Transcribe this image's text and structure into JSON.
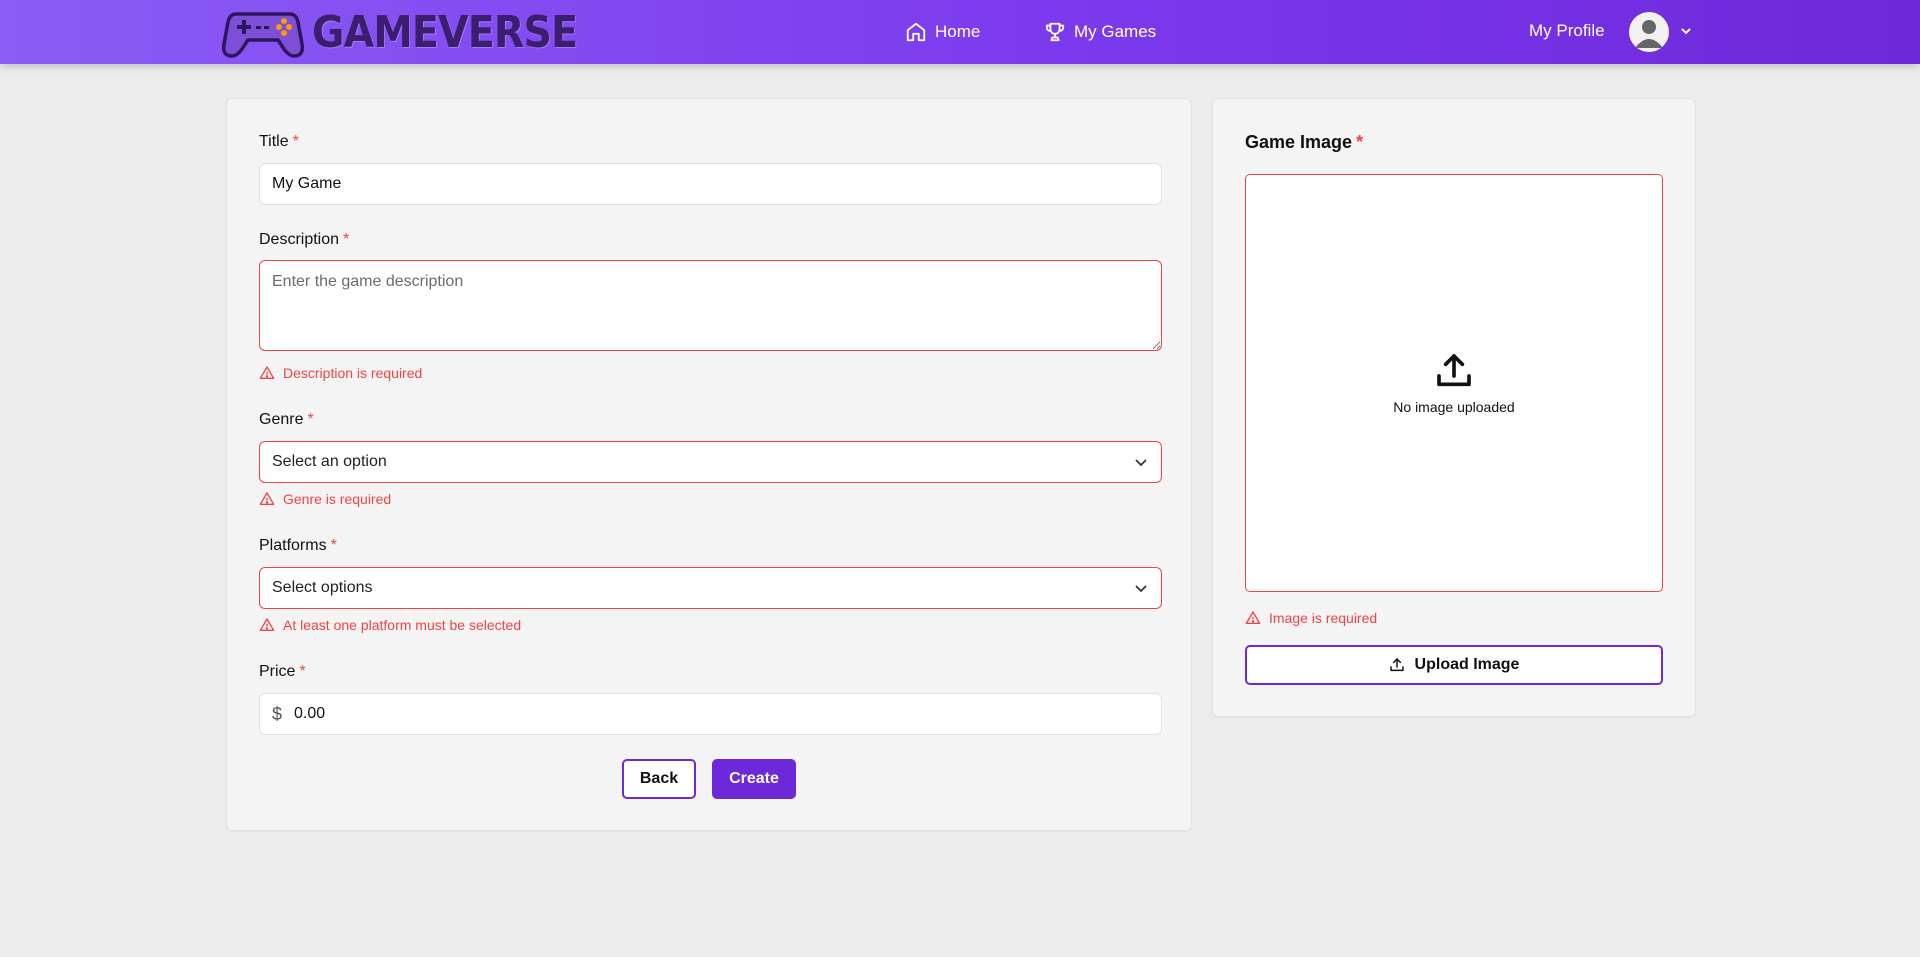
{
  "header": {
    "brand": "GAMEVERSE",
    "nav": [
      {
        "label": "Home",
        "icon": "home-icon"
      },
      {
        "label": "My Games",
        "icon": "trophy-icon"
      }
    ],
    "profile_label": "My Profile"
  },
  "form": {
    "title": {
      "label": "Title",
      "required_mark": "*",
      "value": "My Game"
    },
    "description": {
      "label": "Description",
      "required_mark": "*",
      "placeholder": "Enter the game description",
      "error": "Description is required"
    },
    "genre": {
      "label": "Genre",
      "required_mark": "*",
      "value": "Select an option",
      "error": "Genre is required"
    },
    "platforms": {
      "label": "Platforms",
      "required_mark": "*",
      "value": "Select options",
      "error": "At least one platform must be selected"
    },
    "price": {
      "label": "Price",
      "required_mark": "*",
      "currency_symbol": "$",
      "value": "0.00"
    },
    "back_label": "Back",
    "create_label": "Create"
  },
  "image": {
    "title": "Game Image",
    "required_mark": "*",
    "empty_text": "No image uploaded",
    "error": "Image is required",
    "upload_label": "Upload Image"
  },
  "colors": {
    "accent": "#6d28d9",
    "header_gradient_start": "#8b5cf6",
    "error": "#ef4444",
    "background": "#ececec"
  }
}
